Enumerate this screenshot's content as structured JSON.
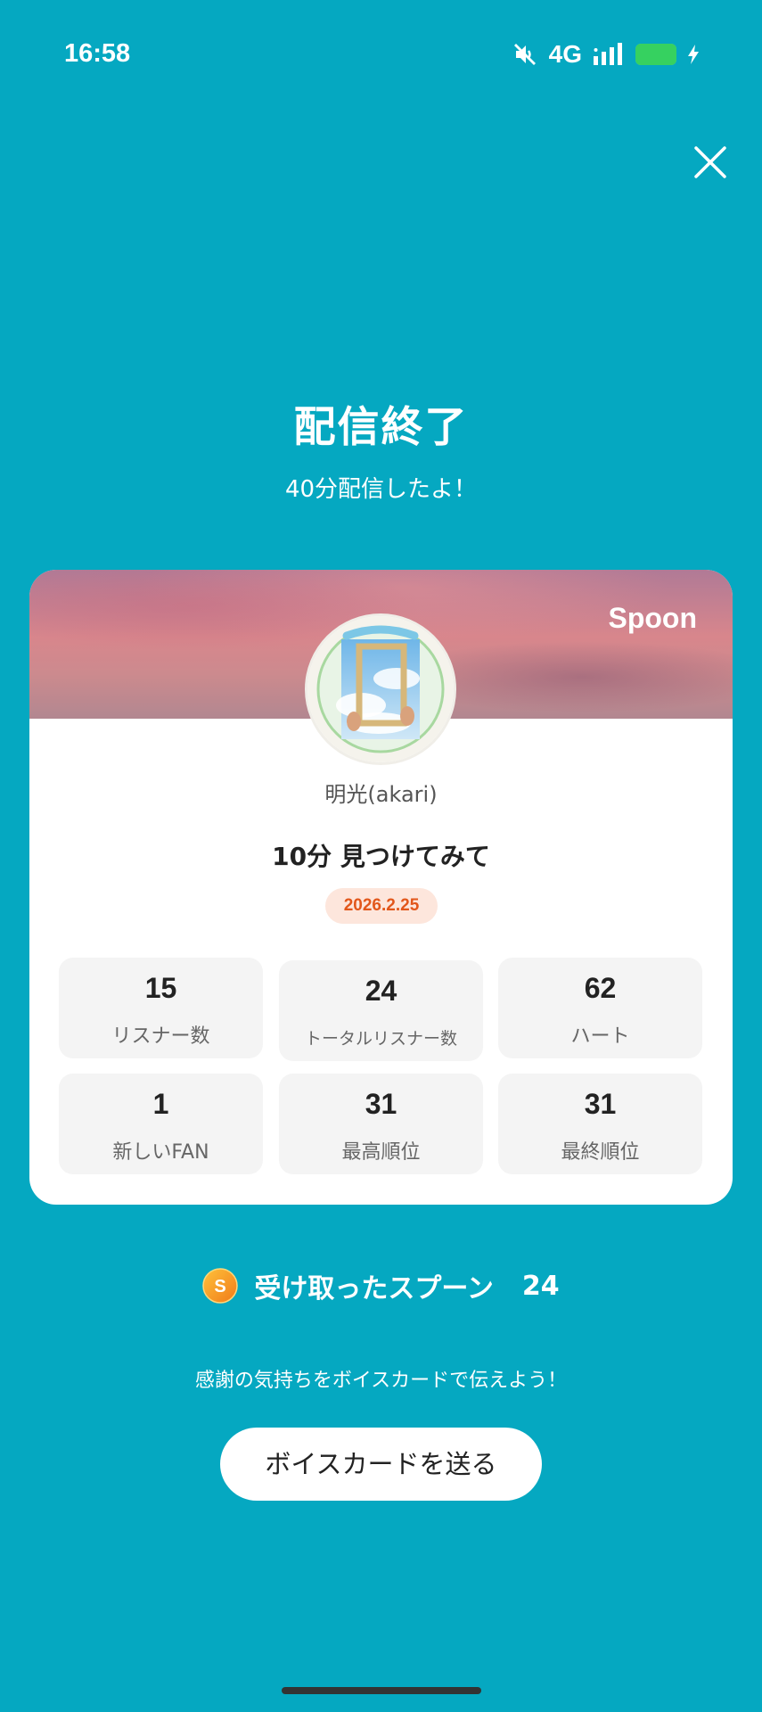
{
  "status_bar": {
    "time": "16:58",
    "network": "4G",
    "icons": [
      "mute-icon",
      "signal-icon",
      "battery-icon",
      "charging-icon"
    ]
  },
  "header": {
    "title": "配信終了",
    "subtitle": "40分配信したよ！"
  },
  "card": {
    "brand": "Spoon",
    "username": "明光(akari)",
    "stream_title": "10分 見つけてみて",
    "date": "2026.2.25",
    "stats": [
      {
        "value": "15",
        "label": "リスナー数"
      },
      {
        "value": "24",
        "label": "トータルリスナー数"
      },
      {
        "value": "62",
        "label": "ハート"
      },
      {
        "value": "1",
        "label": "新しいFAN"
      },
      {
        "value": "31",
        "label": "最高順位"
      },
      {
        "value": "31",
        "label": "最終順位"
      }
    ]
  },
  "received": {
    "label": "受け取ったスプーン",
    "count": "24",
    "icon_letter": "S"
  },
  "thanks_text": "感謝の気持ちをボイスカードで伝えよう！",
  "voice_card_button": "ボイスカードを送る",
  "colors": {
    "background": "#05A8C1",
    "accent_orange": "#E2571B",
    "battery_green": "#36D160"
  }
}
